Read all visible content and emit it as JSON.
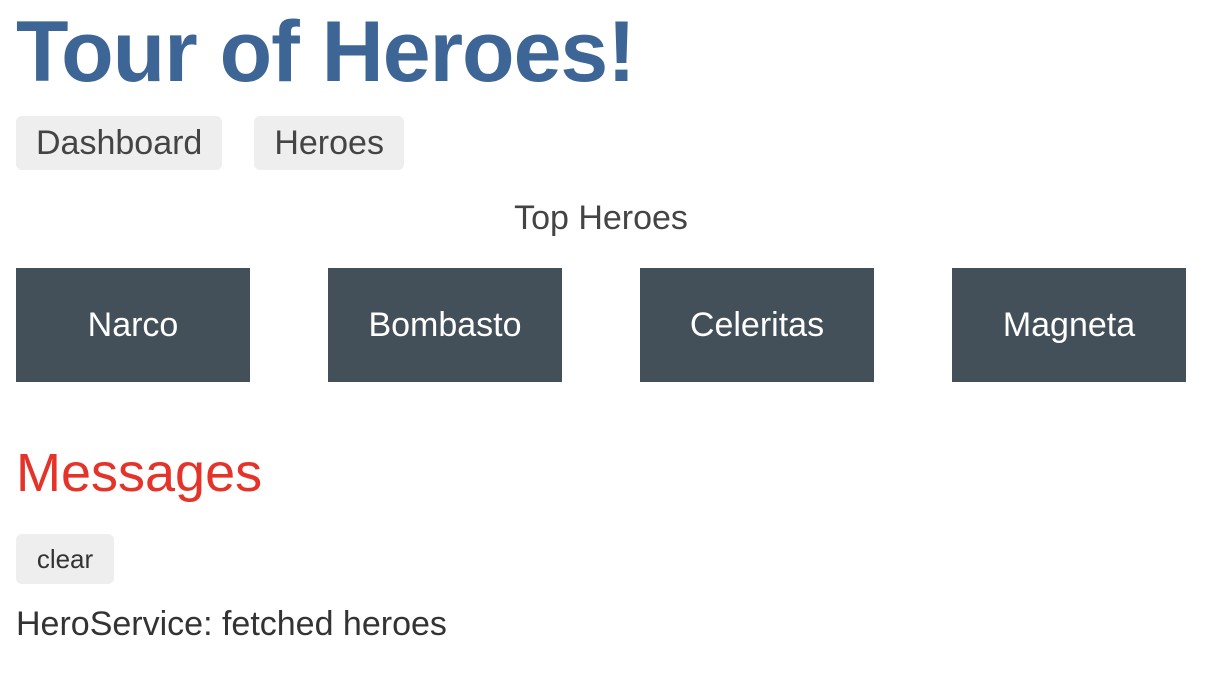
{
  "app": {
    "title": "Tour of Heroes!"
  },
  "nav": {
    "items": [
      {
        "label": "Dashboard"
      },
      {
        "label": "Heroes"
      }
    ]
  },
  "dashboard": {
    "heading": "Top Heroes",
    "heroes": [
      {
        "name": "Narco"
      },
      {
        "name": "Bombasto"
      },
      {
        "name": "Celeritas"
      },
      {
        "name": "Magneta"
      }
    ]
  },
  "messages": {
    "heading": "Messages",
    "clear_label": "clear",
    "items": [
      {
        "text": "HeroService: fetched heroes"
      }
    ]
  },
  "colors": {
    "title": "#3d6696",
    "hero_tile": "#435059",
    "messages_heading": "#e5332a",
    "button_background": "#eeeeee"
  }
}
